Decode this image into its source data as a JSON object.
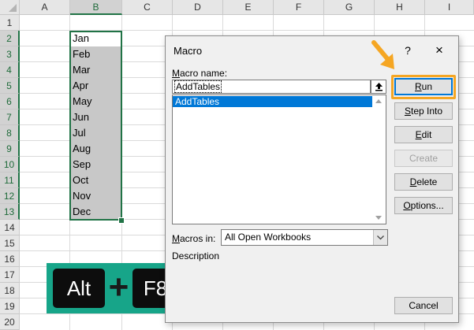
{
  "sheet": {
    "columns": [
      "A",
      "B",
      "C",
      "D",
      "E",
      "F",
      "G",
      "H",
      "I"
    ],
    "rows": [
      "1",
      "2",
      "3",
      "4",
      "5",
      "6",
      "7",
      "8",
      "9",
      "10",
      "11",
      "12",
      "13",
      "14",
      "15",
      "16",
      "17",
      "18",
      "19",
      "20"
    ],
    "cells_b": [
      "Jan",
      "Feb",
      "Mar",
      "Apr",
      "May",
      "Jun",
      "Jul",
      "Aug",
      "Sep",
      "Oct",
      "Nov",
      "Dec"
    ],
    "selected_column": "B",
    "selection_color": "#217346"
  },
  "shortcut": {
    "key1": "Alt",
    "plus": "+",
    "key2": "F8",
    "bg_color": "#17a589"
  },
  "dialog": {
    "title": "Macro",
    "help": "?",
    "close": "×",
    "name_label_prefix": "M",
    "name_label_rest": "acro name:",
    "name_value": "AddTables",
    "list_items": [
      "AddTables"
    ],
    "macros_in_label_prefix": "M",
    "macros_in_label_rest": "acros in:",
    "macros_in_value": "All Open Workbooks",
    "description_label": "Description",
    "buttons": {
      "run_u": "R",
      "run_rest": "un",
      "step_into_u": "S",
      "step_into_rest": "tep Into",
      "edit_u": "E",
      "edit_rest": "dit",
      "create": "Create",
      "delete_u": "D",
      "delete_rest": "elete",
      "options_u": "O",
      "options_rest": "ptions...",
      "cancel": "Cancel"
    },
    "highlight_color": "#f5a623",
    "selection_color": "#0078d7"
  }
}
